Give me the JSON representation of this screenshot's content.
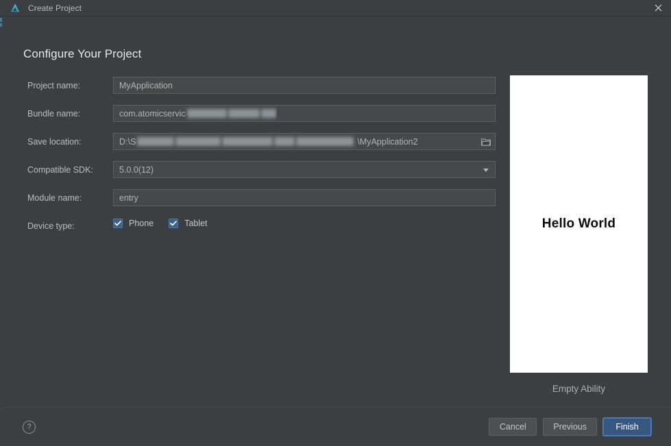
{
  "window": {
    "title": "Create Project",
    "logo_icon": "deveco-logo-icon",
    "close_icon": "close-icon"
  },
  "page": {
    "heading": "Configure Your Project"
  },
  "form": {
    "rows": [
      {
        "label": "Project name:",
        "value": "MyApplication",
        "type": "text"
      },
      {
        "label": "Bundle name:",
        "value": "com.atomicservic",
        "type": "text-redacted",
        "redacted_note": "redacted"
      },
      {
        "label": "Save location:",
        "value": "D:\\S",
        "value_tail": "\\MyApplication2",
        "type": "path-redacted",
        "browse_icon": "folder-open-icon"
      },
      {
        "label": "Compatible SDK:",
        "value": "5.0.0(12)",
        "type": "combo",
        "arrow_icon": "chevron-down-icon"
      },
      {
        "label": "Module name:",
        "value": "entry",
        "type": "text"
      },
      {
        "label": "Device type:",
        "type": "checkboxes"
      }
    ],
    "device_types": [
      {
        "label": "Phone",
        "checked": true
      },
      {
        "label": "Tablet",
        "checked": true
      }
    ]
  },
  "preview": {
    "screen_text": "Hello World",
    "caption": "Empty Ability"
  },
  "footer": {
    "help_label": "?",
    "buttons": [
      {
        "label": "Cancel",
        "primary": false
      },
      {
        "label": "Previous",
        "primary": false
      },
      {
        "label": "Finish",
        "primary": true
      }
    ]
  },
  "colors": {
    "window_bg": "#3c3f41",
    "field_bg": "#45494a",
    "field_border": "#5e6060",
    "accent": "#365880",
    "checkbox": "#3d6185",
    "text": "#bdbdbd",
    "heading": "#e8e8e8",
    "preview_screen": "#ffffff"
  }
}
